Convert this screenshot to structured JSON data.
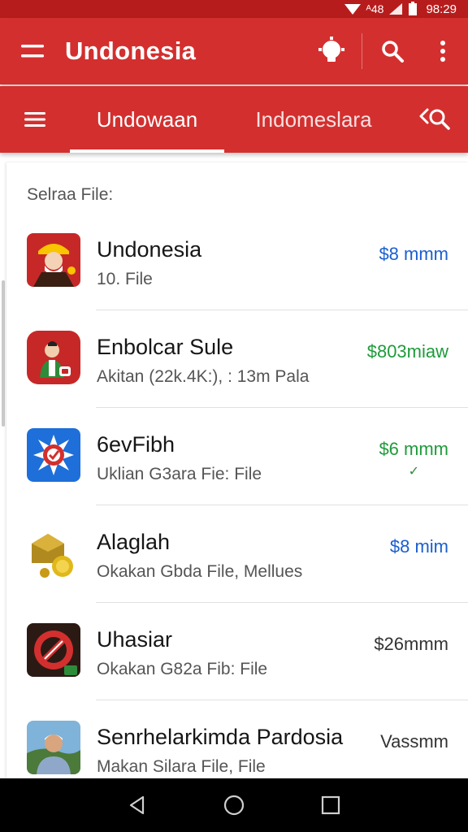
{
  "status": {
    "time": "98:29",
    "network": "ᴬ48"
  },
  "app_bar": {
    "title": "Undonesia"
  },
  "tabs": [
    {
      "label": "Undowaan",
      "active": true
    },
    {
      "label": "Indomeslara",
      "active": false
    }
  ],
  "section": {
    "label": "Selraa File:"
  },
  "items": [
    {
      "name": "Undonesia",
      "sub": "10. File",
      "price": "$8 mmm",
      "price_color": "#1a5fd0",
      "icon": "worker-avatar-icon"
    },
    {
      "name": "Enbolcar Sule",
      "sub": "Akitan (22k.4K:), : 13m Pala",
      "price": "$803miaw",
      "price_color": "#1e9b3a",
      "icon": "person-badge-icon"
    },
    {
      "name": "6evFibh",
      "sub": "Uklian G3ara Fie: File",
      "price": "$6 mmm",
      "price_color": "#1e9b3a",
      "check": "✓",
      "icon": "compass-badge-icon"
    },
    {
      "name": "Alaglah",
      "sub": "Okakan Gbda File, Mellues",
      "price": "$8 mim",
      "price_color": "#1a5fd0",
      "icon": "coin-box-icon"
    },
    {
      "name": "Uhasiar",
      "sub": "Okakan G82a Fib: File",
      "price": "$26mmm",
      "price_color": "#333333",
      "icon": "no-sign-icon"
    },
    {
      "name": "Senrhelarkimda Pardosia",
      "sub": "Makan Silara File, File",
      "price": "Vassmm",
      "price_color": "#333333",
      "icon": "person-photo-icon"
    }
  ],
  "colors": {
    "primary": "#d32f2f",
    "status": "#b71c1c"
  }
}
